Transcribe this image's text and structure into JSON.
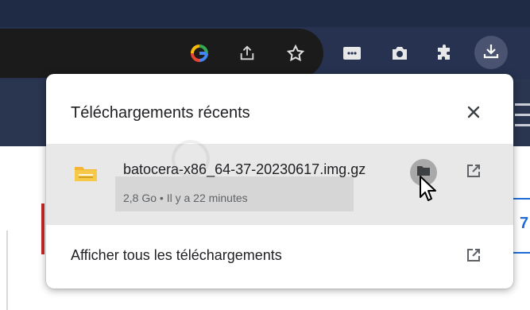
{
  "toolbar": {
    "icons": [
      "google-icon",
      "share-icon",
      "bookmark-star-icon",
      "extension-dots-icon",
      "camera-icon",
      "puzzle-icon",
      "download-icon"
    ],
    "download_button_label": ""
  },
  "colors": {
    "chrome_dark": "#263250",
    "omnibox": "#1b1b1b",
    "popup_bg": "#ffffff",
    "item_hover": "#e8e8e8",
    "text_primary": "#202124",
    "text_secondary": "#5f6368",
    "accent_blue": "#1e6dd6",
    "accent_red": "#c62828"
  },
  "popup": {
    "title": "Téléchargements récents",
    "close_icon": "close-icon",
    "item": {
      "file_name": "batocera-x86_64-37-20230617.img.gz",
      "meta": "2,8 Go • Il y a 22 minutes",
      "icon": "archive-folder-icon"
    },
    "show_all_label": "Afficher tous les téléchargements"
  },
  "background_page": {
    "peek_text": "7"
  }
}
